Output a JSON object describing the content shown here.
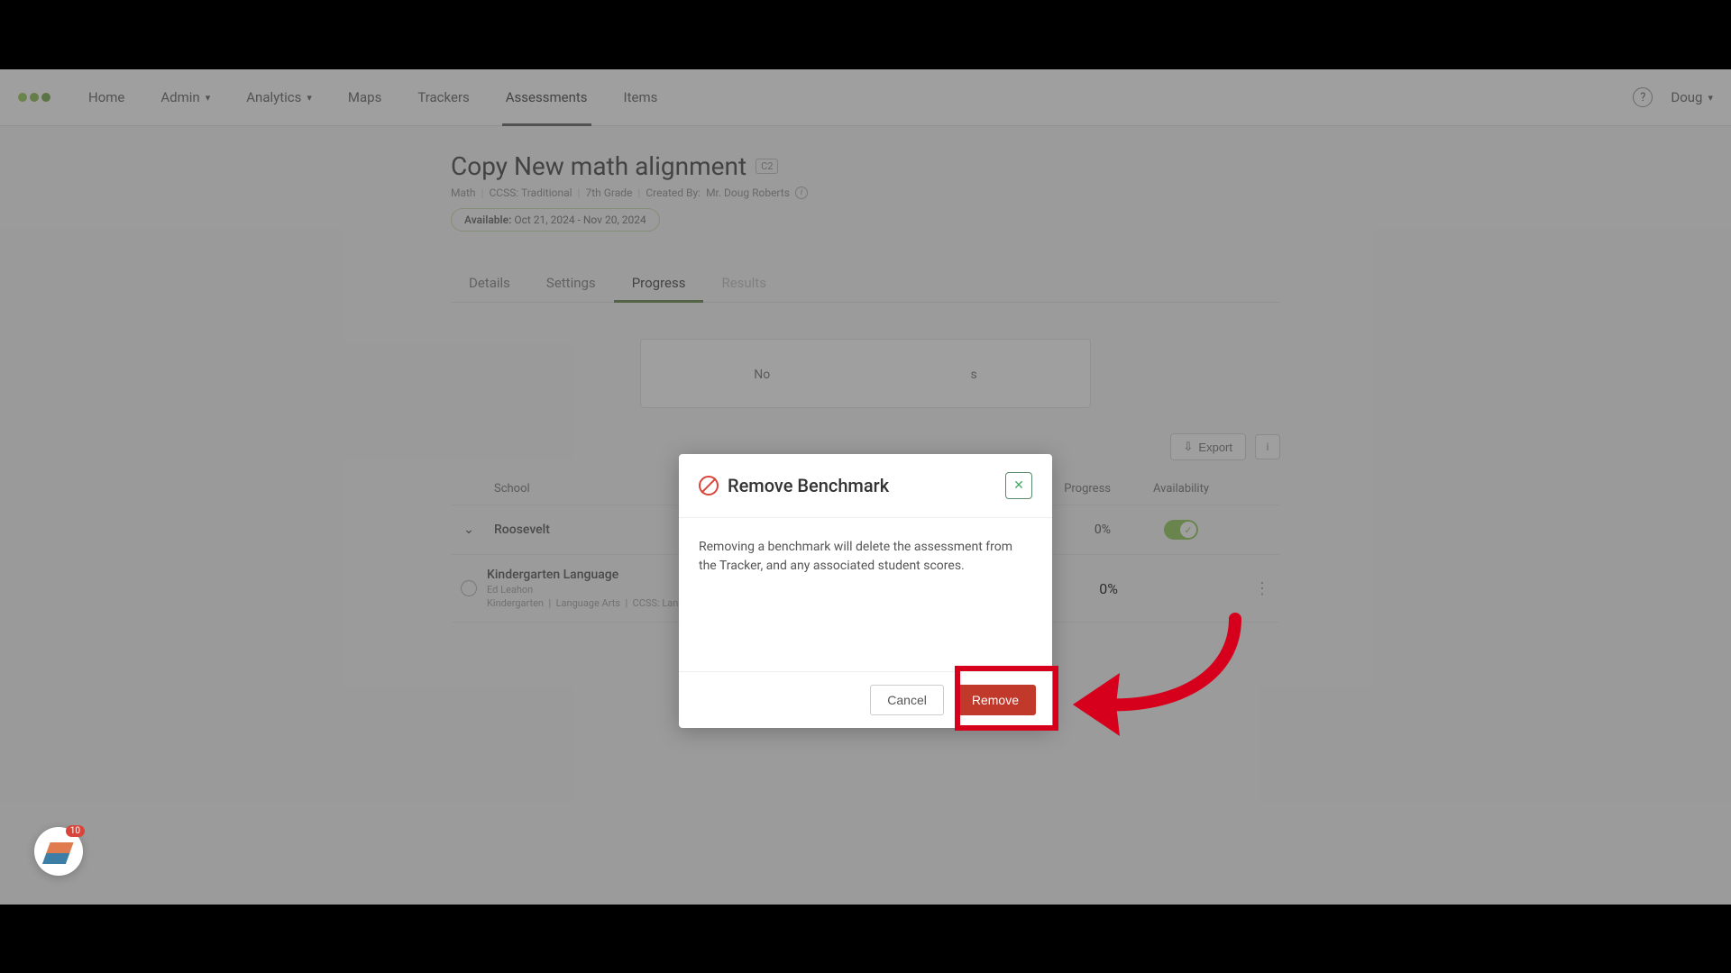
{
  "nav": {
    "items": [
      "Home",
      "Admin",
      "Analytics",
      "Maps",
      "Trackers",
      "Assessments",
      "Items"
    ],
    "user": "Doug"
  },
  "page": {
    "title": "Copy New math alignment",
    "badge": "C2",
    "meta": {
      "subject": "Math",
      "standard": "CCSS: Traditional",
      "grade": "7th Grade",
      "created_by_label": "Created By:",
      "created_by": "Mr. Doug Roberts"
    },
    "availability": {
      "label": "Available:",
      "range": "Oct 21, 2024 - Nov 20, 2024"
    }
  },
  "tabs": [
    "Details",
    "Settings",
    "Progress",
    "Results"
  ],
  "card": {
    "text_prefix": "No",
    "text_suffix": "s"
  },
  "toolbar": {
    "export": "Export"
  },
  "table": {
    "headers": {
      "school": "School",
      "progress": "Progress",
      "availability": "Availability"
    },
    "rows": [
      {
        "school": "Roosevelt",
        "progress": "0%"
      }
    ],
    "subrow": {
      "title": "Kindergarten Language",
      "teacher": "Ed Leahon",
      "meta1": "Kindergarten",
      "meta2": "Language Arts",
      "meta3": "CCSS: Language Arts",
      "progress": "0%"
    }
  },
  "modal": {
    "title": "Remove Benchmark",
    "body": "Removing a benchmark will delete the assessment from the Tracker, and any associated student scores.",
    "cancel": "Cancel",
    "remove": "Remove"
  },
  "badge": {
    "count": "10"
  }
}
